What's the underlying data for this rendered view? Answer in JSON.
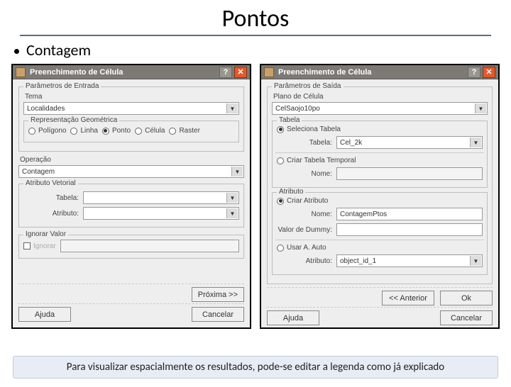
{
  "slide": {
    "title": "Pontos",
    "bullet": "Contagem",
    "footnote": "Para visualizar espacialmente os resultados, pode-se editar a legenda como já explicado"
  },
  "left": {
    "title": "Preenchimento de Célula",
    "grp_entrada": "Parâmetros de Entrada",
    "tema_lbl": "Tema",
    "tema_val": "Localidades",
    "rep_lbl": "Representação Geométrica",
    "rep_options": {
      "pol": "Polígono",
      "lin": "Linha",
      "pon": "Ponto",
      "cel": "Célula",
      "ras": "Raster"
    },
    "op_lbl": "Operação",
    "op_val": "Contagem",
    "atrib_lbl": "Atributo Vetorial",
    "tabela_lbl": "Tabela:",
    "atributo_lbl": "Atributo:",
    "ignore_lbl": "Ignorar Valor",
    "ignore_chk": "Ignorar",
    "btn_prox": "Próxima >>",
    "btn_ajuda": "Ajuda",
    "btn_cancelar": "Cancelar"
  },
  "right": {
    "title": "Preenchimento de Célula",
    "grp_saida": "Parâmetros de Saída",
    "plano_lbl": "Plano de Célula",
    "plano_val": "CelSaojo10po",
    "tabela_lbl": "Tabela",
    "sel_tabela": "Seleciona Tabela",
    "tabela_row_lbl": "Tabela:",
    "tabela_val": "Cel_2k",
    "criar_tabela": "Criar Tabela Temporal",
    "nome_lbl": "Nome:",
    "atrib_grp": "Atributo",
    "criar_atrib": "Criar Atributo",
    "nome_atrib_lbl": "Nome:",
    "nome_atrib_val": "ContagemPtos",
    "dummy_lbl": "Valor de Dummy:",
    "usar_auto": "Usar A. Auto",
    "atrib_sel_lbl": "Atributo:",
    "atrib_sel_val": "object_id_1",
    "btn_prev": "<< Anterior",
    "btn_ok": "Ok",
    "btn_ajuda": "Ajuda",
    "btn_cancelar": "Cancelar"
  }
}
